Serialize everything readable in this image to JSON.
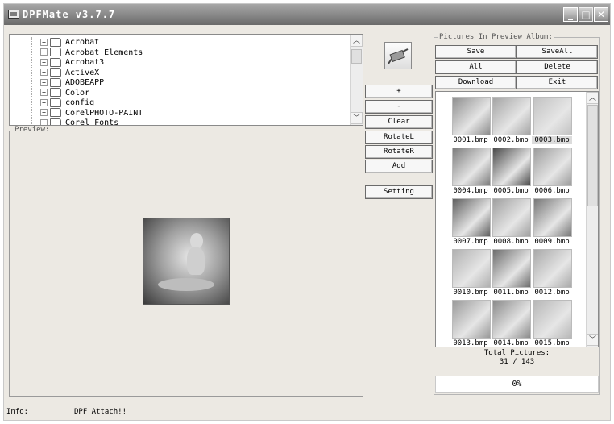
{
  "window": {
    "title": "DPFMate v3.7.7"
  },
  "tree": {
    "items": [
      "Acrobat",
      "Acrobat Elements",
      "Acrobat3",
      "ActiveX",
      "ADOBEAPP",
      "Color",
      "config",
      "CorelPHOTO-PAINT",
      "Corel_Fonts"
    ]
  },
  "preview": {
    "legend": "Preview:"
  },
  "middle_buttons": {
    "plus": "+",
    "minus": "-",
    "clear": "Clear",
    "rotate_left": "RotateL",
    "rotate_right": "RotateR",
    "add": "Add",
    "setting": "Setting"
  },
  "album": {
    "legend": "Pictures In Preview Album:",
    "save": "Save",
    "save_all": "SaveAll",
    "all": "All",
    "delete": "Delete",
    "download": "Download",
    "exit": "Exit",
    "thumbnails": [
      {
        "name": "0001.bmp",
        "color": "#8e8e8e"
      },
      {
        "name": "0002.bmp",
        "color": "#a4a4a4"
      },
      {
        "name": "0003.bmp",
        "color": "#c2c2c2"
      },
      {
        "name": "0004.bmp",
        "color": "#7d7d7d"
      },
      {
        "name": "0005.bmp",
        "color": "#4a4a4a"
      },
      {
        "name": "0006.bmp",
        "color": "#9c9c9c"
      },
      {
        "name": "0007.bmp",
        "color": "#5f5f5f"
      },
      {
        "name": "0008.bmp",
        "color": "#a0a0a0"
      },
      {
        "name": "0009.bmp",
        "color": "#777777"
      },
      {
        "name": "0010.bmp",
        "color": "#b0b0b0"
      },
      {
        "name": "0011.bmp",
        "color": "#6c6c6c"
      },
      {
        "name": "0012.bmp",
        "color": "#a9a9a9"
      },
      {
        "name": "0013.bmp",
        "color": "#9a9a9a"
      },
      {
        "name": "0014.bmp",
        "color": "#8a8a8a"
      },
      {
        "name": "0015.bmp",
        "color": "#b7b7b7"
      }
    ],
    "total_label": "Total Pictures:",
    "total_value": "31 / 143",
    "progress_text": "0%",
    "progress_fraction": 0
  },
  "status": {
    "label": "Info:",
    "message": "DPF Attach!!"
  }
}
